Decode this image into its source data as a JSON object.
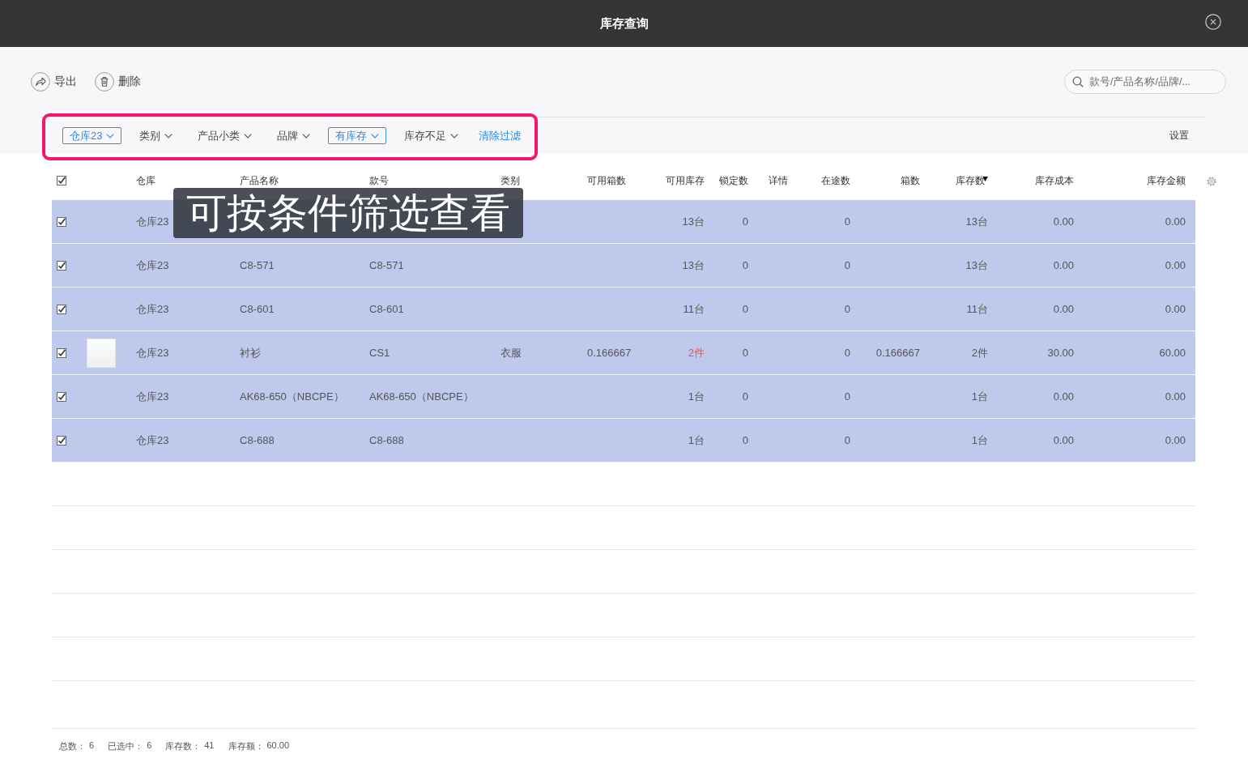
{
  "window": {
    "title": "库存查询"
  },
  "toolbar": {
    "buttons": [
      {
        "label": "导出",
        "kind": "export"
      },
      {
        "label": "删除",
        "kind": "delete"
      }
    ],
    "search": {
      "placeholder": "款号/产品名称/品牌/..."
    }
  },
  "filters": {
    "items": [
      {
        "label": "仓库23",
        "kind": "dropdown",
        "selected": true
      },
      {
        "label": "类别",
        "kind": "dropdown",
        "selected": false
      },
      {
        "label": "产品小类",
        "kind": "dropdown",
        "selected": false
      },
      {
        "label": "品牌",
        "kind": "dropdown",
        "selected": false
      },
      {
        "label": "有库存",
        "kind": "dropdown",
        "selected": true
      },
      {
        "label": "库存不足",
        "kind": "dropdown",
        "selected": false
      },
      {
        "label": "清除过滤",
        "kind": "link",
        "selected": false
      }
    ],
    "settings": "设置"
  },
  "table": {
    "select_all": true,
    "columns": [
      {
        "label": "仓库",
        "sorted": false
      },
      {
        "label": "产品名称",
        "sorted": false
      },
      {
        "label": "款号",
        "sorted": false
      },
      {
        "label": "类别",
        "sorted": false
      },
      {
        "label": "可用箱数",
        "sorted": false
      },
      {
        "label": "可用库存",
        "sorted": false
      },
      {
        "label": "锁定数",
        "sorted": false
      },
      {
        "label": "详情",
        "sorted": false
      },
      {
        "label": "在途数",
        "sorted": false
      },
      {
        "label": "箱数",
        "sorted": false
      },
      {
        "label": "库存数",
        "sorted": true
      },
      {
        "label": "库存成本",
        "sorted": false
      },
      {
        "label": "库存金额",
        "sorted": false
      }
    ],
    "rows": [
      {
        "selected": true,
        "thumbnail": false,
        "stock_alert": false,
        "warehouse": "仓库23",
        "available_stock": "13台",
        "locked": "0",
        "in_transit": "0",
        "stock": "13台",
        "stock_cost": "0.00",
        "stock_amount": "0.00"
      },
      {
        "selected": true,
        "thumbnail": false,
        "stock_alert": false,
        "warehouse": "仓库23",
        "product_name": "C8-571",
        "style_no": "C8-571",
        "available_stock": "13台",
        "locked": "0",
        "in_transit": "0",
        "stock": "13台",
        "stock_cost": "0.00",
        "stock_amount": "0.00"
      },
      {
        "selected": true,
        "thumbnail": false,
        "stock_alert": false,
        "warehouse": "仓库23",
        "product_name": "C8-601",
        "style_no": "C8-601",
        "available_stock": "11台",
        "locked": "0",
        "in_transit": "0",
        "stock": "11台",
        "stock_cost": "0.00",
        "stock_amount": "0.00"
      },
      {
        "selected": true,
        "thumbnail": true,
        "stock_alert": true,
        "warehouse": "仓库23",
        "product_name": "衬衫",
        "style_no": "CS1",
        "category": "衣服",
        "available_boxes": "0.166667",
        "available_stock": "2件",
        "locked": "0",
        "in_transit": "0",
        "boxes": "0.166667",
        "stock": "2件",
        "stock_cost": "30.00",
        "stock_amount": "60.00"
      },
      {
        "selected": true,
        "thumbnail": false,
        "stock_alert": false,
        "warehouse": "仓库23",
        "product_name": "AK68-650（NBCPE）",
        "style_no": "AK68-650（NBCPE）",
        "available_stock": "1台",
        "locked": "0",
        "in_transit": "0",
        "stock": "1台",
        "stock_cost": "0.00",
        "stock_amount": "0.00"
      },
      {
        "selected": true,
        "thumbnail": false,
        "stock_alert": false,
        "warehouse": "仓库23",
        "product_name": "C8-688",
        "style_no": "C8-688",
        "available_stock": "1台",
        "locked": "0",
        "in_transit": "0",
        "stock": "1台",
        "stock_cost": "0.00",
        "stock_amount": "0.00"
      }
    ]
  },
  "overlay": {
    "caption": "可按条件筛选查看"
  },
  "summary": [
    {
      "label": "总数：",
      "value": "6"
    },
    {
      "label": "已选中：",
      "value": "6"
    },
    {
      "label": "库存数：",
      "value": "41"
    },
    {
      "label": "库存额：",
      "value": "60.00"
    }
  ]
}
